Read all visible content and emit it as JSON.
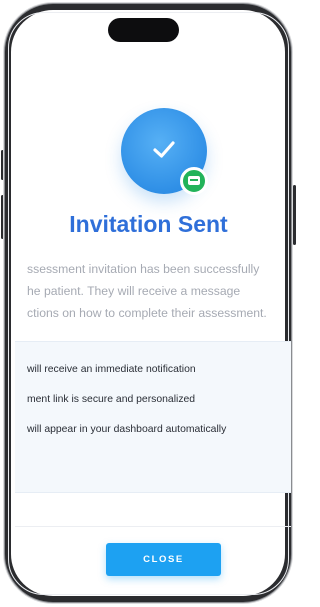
{
  "dialog": {
    "title": "Invitation Sent",
    "description_lines": [
      "ssessment invitation has been successfully",
      "he patient. They will receive a message",
      "ctions on how to complete their assessment."
    ],
    "info_items": [
      "will receive an immediate notification",
      "ment link is secure and personalized",
      "will appear in your dashboard automatically"
    ],
    "close_label": "CLOSE"
  },
  "icons": {
    "status_icon": "checkmark-icon",
    "badge_icon": "message-icon"
  },
  "colors": {
    "accent": "#2f8fe6",
    "title": "#2f6fd9",
    "badge": "#22b35a",
    "button": "#1da1f2"
  }
}
